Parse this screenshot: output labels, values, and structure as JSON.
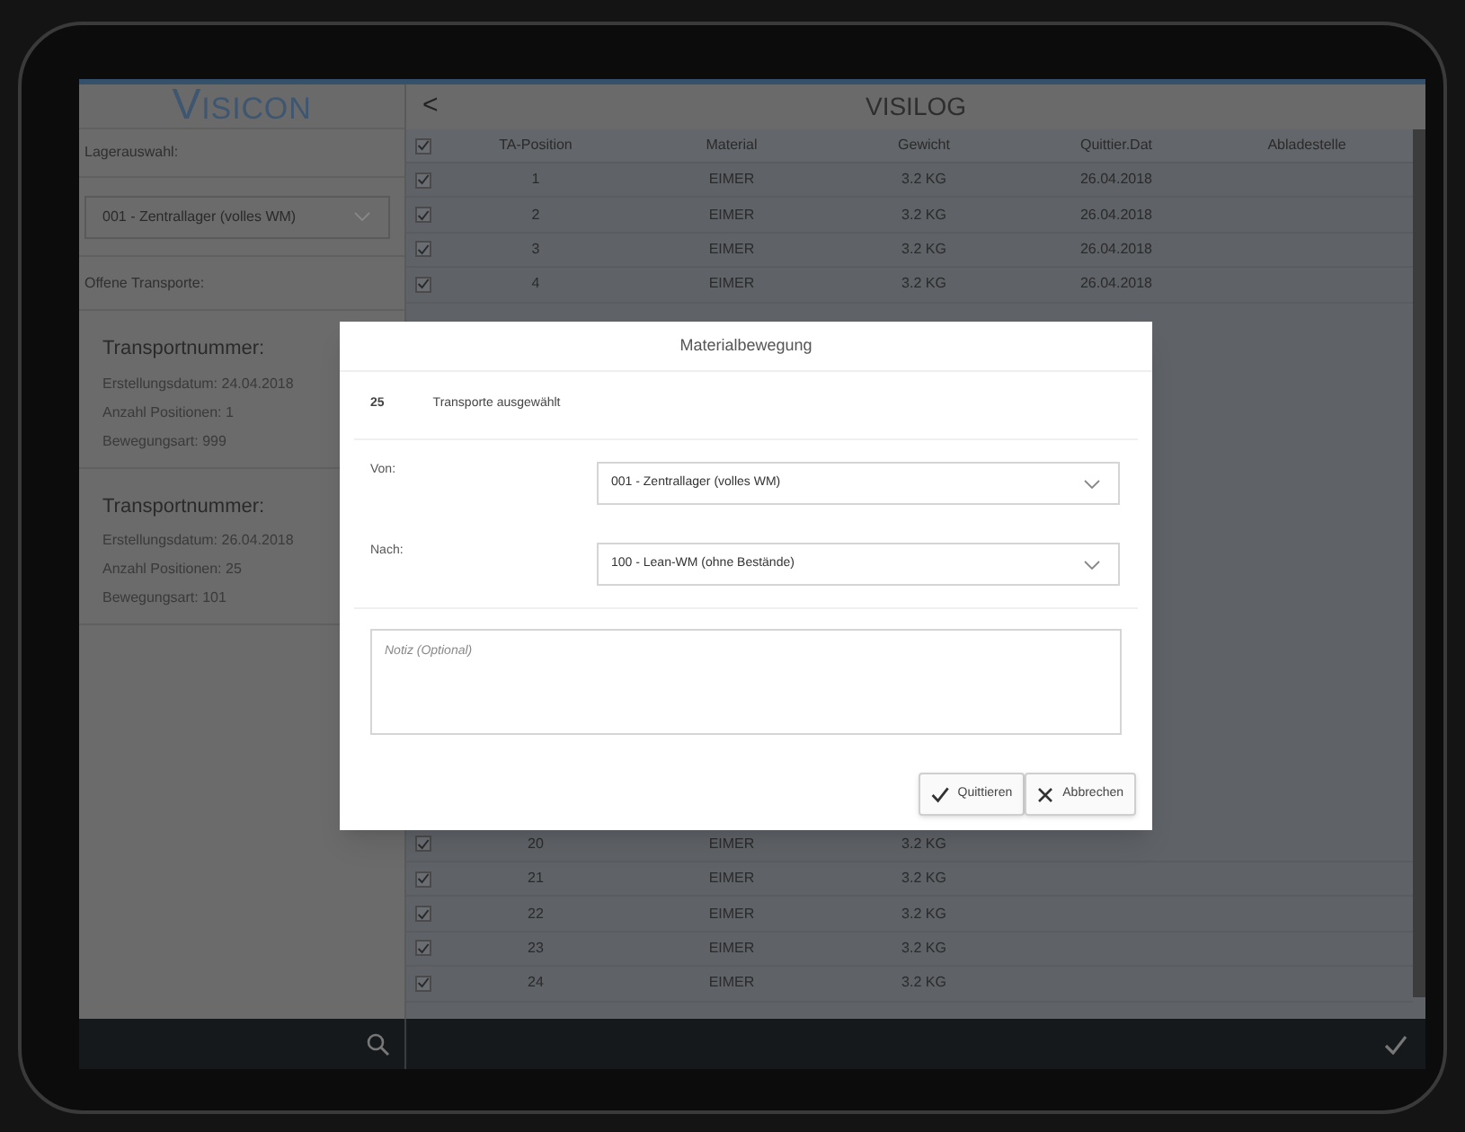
{
  "sidebar": {
    "logo": "VISICON",
    "warehouse_label": "Lagerauswahl:",
    "warehouse_select": "001 - Zentrallager (volles WM)",
    "open_label": "Offene Transporte:",
    "transports": [
      {
        "title": "Transportnummer:",
        "lines": [
          "Erstellungsdatum: 24.04.2018",
          "Anzahl Positionen: 1",
          "Bewegungsart: 999"
        ]
      },
      {
        "title": "Transportnummer:",
        "lines": [
          "Erstellungsdatum: 26.04.2018",
          "Anzahl Positionen: 25",
          "Bewegungsart: 101"
        ]
      }
    ]
  },
  "header": {
    "back": "<",
    "title": "VISILOG"
  },
  "table": {
    "header_checked": true,
    "columns": [
      "TA-Position",
      "Material",
      "Gewicht",
      "Quittier.Dat",
      "Abladestelle"
    ],
    "rows_top": [
      {
        "checked": true,
        "cells": [
          "1",
          "EIMER",
          "3.2 KG",
          "26.04.2018",
          ""
        ]
      },
      {
        "checked": true,
        "cells": [
          "2",
          "EIMER",
          "3.2 KG",
          "26.04.2018",
          ""
        ]
      },
      {
        "checked": true,
        "cells": [
          "3",
          "EIMER",
          "3.2 KG",
          "26.04.2018",
          ""
        ]
      },
      {
        "checked": true,
        "cells": [
          "4",
          "EIMER",
          "3.2 KG",
          "26.04.2018",
          ""
        ]
      }
    ],
    "rows_bottom": [
      {
        "checked": true,
        "cells": [
          "20",
          "EIMER",
          "3.2 KG",
          "",
          ""
        ]
      },
      {
        "checked": true,
        "cells": [
          "21",
          "EIMER",
          "3.2 KG",
          "",
          ""
        ]
      },
      {
        "checked": true,
        "cells": [
          "22",
          "EIMER",
          "3.2 KG",
          "",
          ""
        ]
      },
      {
        "checked": true,
        "cells": [
          "23",
          "EIMER",
          "3.2 KG",
          "",
          ""
        ]
      },
      {
        "checked": true,
        "cells": [
          "24",
          "EIMER",
          "3.2 KG",
          "",
          ""
        ]
      }
    ]
  },
  "dialog": {
    "title": "Materialbewegung",
    "count": "25",
    "count_label": "Transporte ausgewählt",
    "fields": [
      {
        "label": "Von:",
        "value": "001 - Zentrallager (volles WM)"
      },
      {
        "label": "Nach:",
        "value": "100 - Lean-WM (ohne Bestände)"
      }
    ],
    "note_placeholder": "Notiz (Optional)",
    "buttons": [
      {
        "kind": "confirm",
        "label": "Quittieren"
      },
      {
        "kind": "cancel",
        "label": "Abbrechen"
      }
    ]
  }
}
